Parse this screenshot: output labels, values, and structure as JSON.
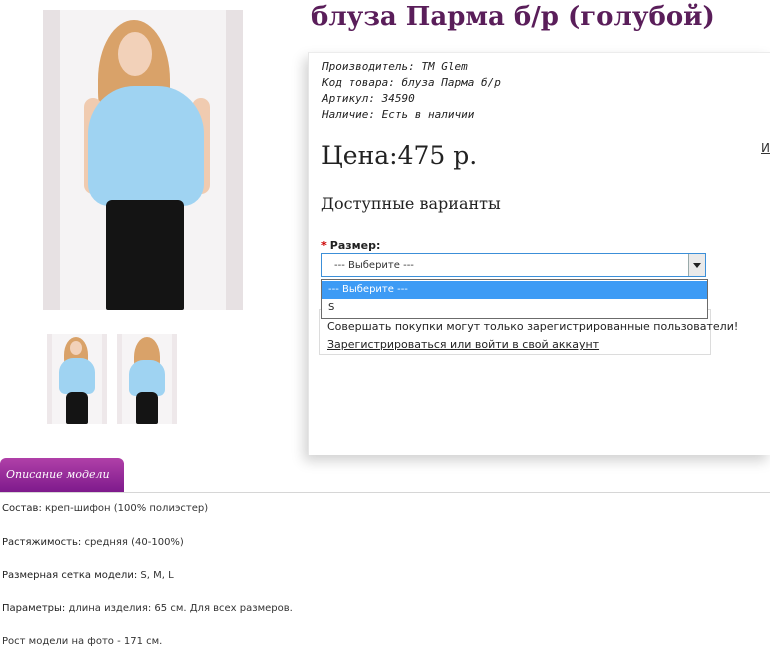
{
  "product": {
    "title": "блуза Парма б/р (голубой)",
    "info": {
      "manufacturer_label": "Производитель:",
      "manufacturer_value": "TM Glem",
      "code_label": "Код товара:",
      "code_value": "блуза Парма б/р",
      "article_label": "Артикул:",
      "article_value": "34590",
      "availability_label": "Наличие:",
      "availability_value": "Есть в наличии"
    },
    "price": "Цена:475 р.",
    "cut_link": "И",
    "variants_heading": "Доступные варианты",
    "size": {
      "required_mark": "*",
      "label": "Размер:",
      "selected": "--- Выберите ---",
      "options": [
        "--- Выберите ---",
        "S"
      ]
    },
    "notice": {
      "message": "Совершать покупки могут только зарегистрированные пользователи!",
      "link": "Зарегистрироваться или войти в свой аккаунт"
    }
  },
  "tabs": {
    "active": "Описание модели"
  },
  "description": [
    {
      "key": "Состав:",
      "value": " креп-шифон (100% полиэстер)"
    },
    {
      "key": "Растяжимость:",
      "value": " средняя (40-100%)"
    },
    {
      "key": "Размерная сетка модели:",
      "value": " S, M, L"
    },
    {
      "key": "Параметры:",
      "value": " длина изделия: 65 см. Для всех размеров."
    },
    {
      "key": "",
      "value": "Рост модели на фото - 171 см."
    }
  ],
  "colors": {
    "title": "#5a1e5a",
    "tab_top": "#b040a8",
    "tab_bottom": "#7e1a8c",
    "select_border": "#3c8fd8",
    "option_highlight": "#3d9bf5",
    "blouse": "#9fd3f2"
  },
  "images": {
    "main": "model-front-photo",
    "thumbnails": [
      "model-front-thumbnail",
      "model-back-thumbnail"
    ]
  }
}
